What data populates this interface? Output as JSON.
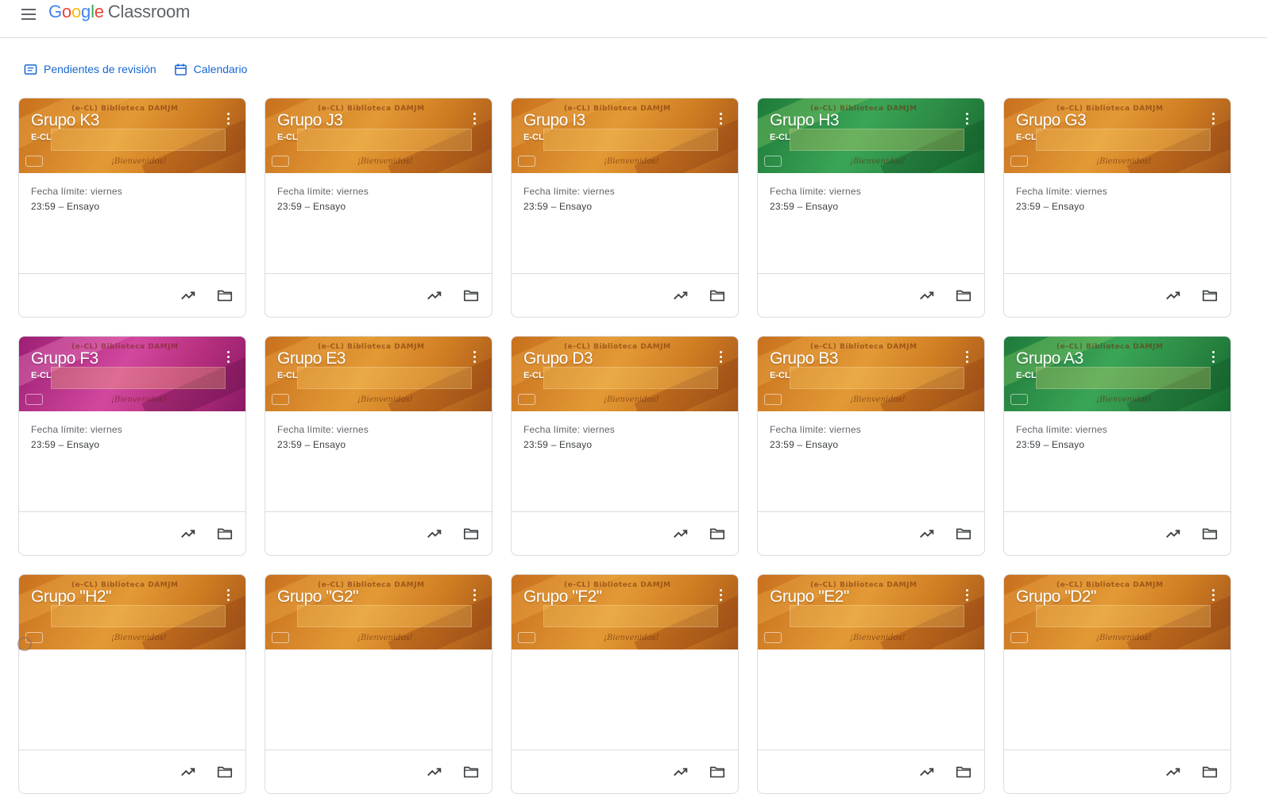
{
  "header": {
    "logo_parts": [
      "G",
      "o",
      "o",
      "g",
      "l",
      "e"
    ],
    "product": "Classroom"
  },
  "toolbar": {
    "to_review": "Pendientes de revisión",
    "calendar": "Calendario"
  },
  "banner_brand": "(e-CL) Biblioteca DAMJM",
  "banner_welcome": "¡Bienvenidos!",
  "colors": {
    "link": "#1967d2",
    "orange": "#d9821e",
    "green": "#2e9b4a",
    "pink": "#c2338f"
  },
  "cards": [
    {
      "title": "Grupo K3",
      "section": "E-CL",
      "due_line1": "Fecha límite: viernes",
      "due_line2": "23:59 – Ensayo",
      "theme": "orange"
    },
    {
      "title": "Grupo J3",
      "section": "E-CL",
      "due_line1": "Fecha límite: viernes",
      "due_line2": "23:59 – Ensayo",
      "theme": "orange"
    },
    {
      "title": "Grupo I3",
      "section": "E-CL",
      "due_line1": "Fecha límite: viernes",
      "due_line2": "23:59 – Ensayo",
      "theme": "orange"
    },
    {
      "title": "Grupo H3",
      "section": "E-CL",
      "due_line1": "Fecha límite: viernes",
      "due_line2": "23:59 – Ensayo",
      "theme": "green"
    },
    {
      "title": "Grupo G3",
      "section": "E-CL",
      "due_line1": "Fecha límite: viernes",
      "due_line2": "23:59 – Ensayo",
      "theme": "orange"
    },
    {
      "title": "Grupo F3",
      "section": "E-CL",
      "due_line1": "Fecha límite: viernes",
      "due_line2": "23:59 – Ensayo",
      "theme": "pink"
    },
    {
      "title": "Grupo E3",
      "section": "E-CL",
      "due_line1": "Fecha límite: viernes",
      "due_line2": "23:59 – Ensayo",
      "theme": "orange"
    },
    {
      "title": "Grupo D3",
      "section": "E-CL",
      "due_line1": "Fecha límite: viernes",
      "due_line2": "23:59 – Ensayo",
      "theme": "orange"
    },
    {
      "title": "Grupo B3",
      "section": "E-CL",
      "due_line1": "Fecha límite: viernes",
      "due_line2": "23:59 – Ensayo",
      "theme": "orange"
    },
    {
      "title": "Grupo A3",
      "section": "E-CL",
      "due_line1": "Fecha límite: viernes",
      "due_line2": "23:59 – Ensayo",
      "theme": "green"
    },
    {
      "title": "Grupo \"H2\"",
      "section": "",
      "due_line1": "",
      "due_line2": "",
      "theme": "orange"
    },
    {
      "title": "Grupo \"G2\"",
      "section": "",
      "due_line1": "",
      "due_line2": "",
      "theme": "orange"
    },
    {
      "title": "Grupo \"F2\"",
      "section": "",
      "due_line1": "",
      "due_line2": "",
      "theme": "orange"
    },
    {
      "title": "Grupo \"E2\"",
      "section": "",
      "due_line1": "",
      "due_line2": "",
      "theme": "orange"
    },
    {
      "title": "Grupo \"D2\"",
      "section": "",
      "due_line1": "",
      "due_line2": "",
      "theme": "orange"
    }
  ],
  "icons": {
    "menu": "menu-icon",
    "review": "assignment-review-icon",
    "calendar": "calendar-icon",
    "more": "more-vert-icon",
    "progress": "trending-up-icon",
    "folder": "folder-icon"
  }
}
